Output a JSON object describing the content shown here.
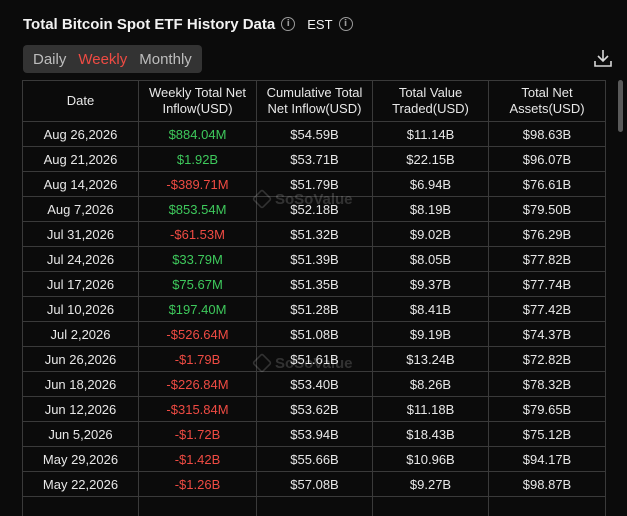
{
  "header": {
    "title": "Total Bitcoin Spot ETF History Data",
    "timezone": "EST"
  },
  "tabs": [
    {
      "label": "Daily",
      "active": false
    },
    {
      "label": "Weekly",
      "active": true
    },
    {
      "label": "Monthly",
      "active": false
    }
  ],
  "watermark": "SoSoValue",
  "colors": {
    "positive": "#3ec95c",
    "negative": "#ef4b43",
    "accent": "#ef4b43"
  },
  "table": {
    "columns": [
      "Date",
      "Weekly Total Net Inflow(USD)",
      "Cumulative Total Net Inflow(USD)",
      "Total Value Traded(USD)",
      "Total Net Assets(USD)"
    ],
    "rows": [
      [
        "Aug 26,2026",
        "$884.04M",
        "$54.59B",
        "$11.14B",
        "$98.63B"
      ],
      [
        "Aug 21,2026",
        "$1.92B",
        "$53.71B",
        "$22.15B",
        "$96.07B"
      ],
      [
        "Aug 14,2026",
        "-$389.71M",
        "$51.79B",
        "$6.94B",
        "$76.61B"
      ],
      [
        "Aug 7,2026",
        "$853.54M",
        "$52.18B",
        "$8.19B",
        "$79.50B"
      ],
      [
        "Jul 31,2026",
        "-$61.53M",
        "$51.32B",
        "$9.02B",
        "$76.29B"
      ],
      [
        "Jul 24,2026",
        "$33.79M",
        "$51.39B",
        "$8.05B",
        "$77.82B"
      ],
      [
        "Jul 17,2026",
        "$75.67M",
        "$51.35B",
        "$9.37B",
        "$77.74B"
      ],
      [
        "Jul 10,2026",
        "$197.40M",
        "$51.28B",
        "$8.41B",
        "$77.42B"
      ],
      [
        "Jul 2,2026",
        "-$526.64M",
        "$51.08B",
        "$9.19B",
        "$74.37B"
      ],
      [
        "Jun 26,2026",
        "-$1.79B",
        "$51.61B",
        "$13.24B",
        "$72.82B"
      ],
      [
        "Jun 18,2026",
        "-$226.84M",
        "$53.40B",
        "$8.26B",
        "$78.32B"
      ],
      [
        "Jun 12,2026",
        "-$315.84M",
        "$53.62B",
        "$11.18B",
        "$79.65B"
      ],
      [
        "Jun 5,2026",
        "-$1.72B",
        "$53.94B",
        "$18.43B",
        "$75.12B"
      ],
      [
        "May 29,2026",
        "-$1.42B",
        "$55.66B",
        "$10.96B",
        "$94.17B"
      ],
      [
        "May 22,2026",
        "-$1.26B",
        "$57.08B",
        "$9.27B",
        "$98.87B"
      ],
      [
        "",
        "",
        "",
        "",
        ""
      ]
    ]
  }
}
